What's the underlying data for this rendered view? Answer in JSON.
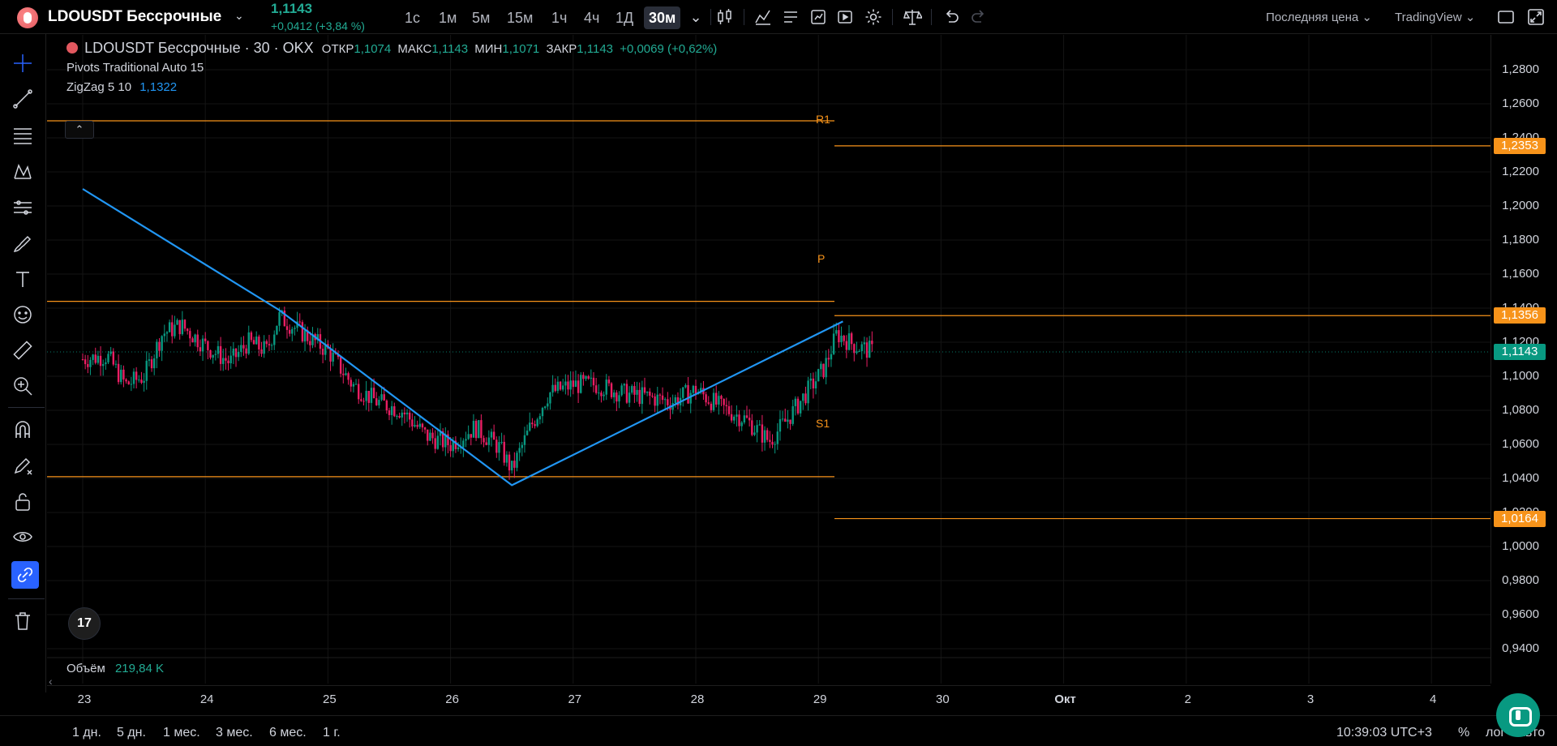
{
  "header": {
    "symbol": "LDOUSDT Бессрочные",
    "last_price": "1,1143",
    "change": "+0,0412 (+3,84 %)",
    "timeframes": [
      "1с",
      "1м",
      "5м",
      "15м",
      "1ч",
      "4ч",
      "1Д",
      "30м"
    ],
    "active_timeframe": "30м",
    "price_source": "Последняя цена",
    "chart_engine": "TradingView"
  },
  "legend": {
    "symbol_line": "LDOUSDT Бессрочные · 30 · OKX",
    "open_label": "ОТКР",
    "open": "1,1074",
    "high_label": "МАКС",
    "high": "1,1143",
    "low_label": "МИН",
    "low": "1,1071",
    "close_label": "ЗАКР",
    "close": "1,1143",
    "change": "+0,0069 (+0,62%)",
    "indicator_1": "Pivots Traditional Auto 15",
    "indicator_2_name": "ZigZag 5 10",
    "indicator_2_value": "1,1322",
    "volume_label": "Объём",
    "volume_value": "219,84 K",
    "tv_logo": "17"
  },
  "price_axis": {
    "ticks": [
      "1,2800",
      "1,2600",
      "1,2400",
      "1,2200",
      "1,2000",
      "1,1800",
      "1,1600",
      "1,1400",
      "1,1200",
      "1,1000",
      "1,0800",
      "1,0600",
      "1,0400",
      "1,0200",
      "1,0000",
      "0,9800",
      "0,9600",
      "0,9400"
    ],
    "badges": {
      "r1": "1,2353",
      "p": "1,1356",
      "last": "1,1143",
      "s1": "1,0164"
    }
  },
  "pivots": {
    "r1_label": "R1",
    "p_label": "P",
    "s1_label": "S1"
  },
  "time_axis": {
    "ticks": [
      "23",
      "24",
      "25",
      "26",
      "27",
      "28",
      "29",
      "30",
      "Окт",
      "2",
      "3",
      "4"
    ]
  },
  "bottom": {
    "ranges": [
      "1 дн.",
      "5 дн.",
      "1 мес.",
      "3 мес.",
      "6 мес.",
      "1 г."
    ],
    "clock": "10:39:03 UTC+3",
    "percent": "%",
    "log": "лог",
    "auto": "авто"
  },
  "colors": {
    "up": "#22ab94",
    "down": "#f23645",
    "candle_up": "#089981",
    "candle_down": "#e91e63",
    "pivot": "#f7931a",
    "zigzag": "#2196f3",
    "accent": "#2962ff"
  },
  "chart_data": {
    "type": "candlestick",
    "x": [
      "23",
      "24",
      "25",
      "26",
      "27",
      "28",
      "29"
    ],
    "ylim": [
      0.93,
      1.29
    ],
    "zigzag": [
      {
        "day": 23.0,
        "price": 1.21
      },
      {
        "day": 24.6,
        "price": 1.139
      },
      {
        "day": 26.5,
        "price": 1.036
      },
      {
        "day": 29.2,
        "price": 1.1322
      }
    ],
    "pivot_levels": [
      {
        "name": "R1",
        "value": 1.2353
      },
      {
        "name": "P",
        "value": 1.1356
      },
      {
        "name": "S1",
        "value": 1.0164
      }
    ],
    "previous_pivot_levels": [
      1.25,
      1.144,
      1.041
    ],
    "close_path": [
      {
        "day": 23.0,
        "close": 1.11
      },
      {
        "day": 23.2,
        "close": 1.112
      },
      {
        "day": 23.35,
        "close": 1.095
      },
      {
        "day": 23.5,
        "close": 1.1
      },
      {
        "day": 23.65,
        "close": 1.125
      },
      {
        "day": 23.8,
        "close": 1.13
      },
      {
        "day": 24.0,
        "close": 1.118
      },
      {
        "day": 24.2,
        "close": 1.108
      },
      {
        "day": 24.35,
        "close": 1.12
      },
      {
        "day": 24.5,
        "close": 1.115
      },
      {
        "day": 24.6,
        "close": 1.135
      },
      {
        "day": 24.8,
        "close": 1.125
      },
      {
        "day": 25.0,
        "close": 1.115
      },
      {
        "day": 25.2,
        "close": 1.095
      },
      {
        "day": 25.4,
        "close": 1.085
      },
      {
        "day": 25.6,
        "close": 1.08
      },
      {
        "day": 25.8,
        "close": 1.065
      },
      {
        "day": 26.0,
        "close": 1.06
      },
      {
        "day": 26.2,
        "close": 1.07
      },
      {
        "day": 26.4,
        "close": 1.058
      },
      {
        "day": 26.5,
        "close": 1.045
      },
      {
        "day": 26.65,
        "close": 1.07
      },
      {
        "day": 26.8,
        "close": 1.09
      },
      {
        "day": 27.0,
        "close": 1.095
      },
      {
        "day": 27.2,
        "close": 1.095
      },
      {
        "day": 27.4,
        "close": 1.09
      },
      {
        "day": 27.6,
        "close": 1.088
      },
      {
        "day": 27.8,
        "close": 1.085
      },
      {
        "day": 28.0,
        "close": 1.092
      },
      {
        "day": 28.2,
        "close": 1.082
      },
      {
        "day": 28.4,
        "close": 1.075
      },
      {
        "day": 28.6,
        "close": 1.062
      },
      {
        "day": 28.75,
        "close": 1.075
      },
      {
        "day": 28.9,
        "close": 1.09
      },
      {
        "day": 29.05,
        "close": 1.105
      },
      {
        "day": 29.15,
        "close": 1.125
      },
      {
        "day": 29.3,
        "close": 1.118
      },
      {
        "day": 29.45,
        "close": 1.1143
      }
    ]
  }
}
